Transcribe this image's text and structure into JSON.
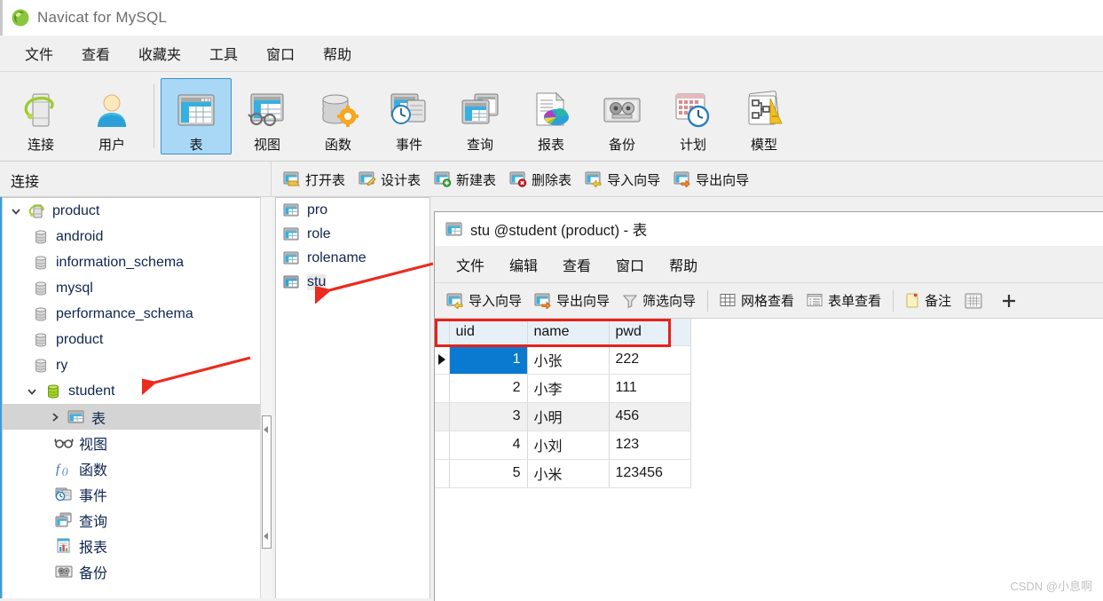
{
  "window": {
    "title": "Navicat for MySQL",
    "app_icon": "navicat-logo-icon"
  },
  "menubar": {
    "items": [
      {
        "label": "文件",
        "name": "menu-file"
      },
      {
        "label": "查看",
        "name": "menu-view"
      },
      {
        "label": "收藏夹",
        "name": "menu-favorites"
      },
      {
        "label": "工具",
        "name": "menu-tools"
      },
      {
        "label": "窗口",
        "name": "menu-window"
      },
      {
        "label": "帮助",
        "name": "menu-help"
      }
    ]
  },
  "toolbar": {
    "buttons": [
      {
        "label": "连接",
        "icon": "connection-icon",
        "selected": false
      },
      {
        "label": "用户",
        "icon": "user-icon",
        "selected": false
      },
      {
        "label": "表",
        "icon": "table-icon",
        "selected": true
      },
      {
        "label": "视图",
        "icon": "view-icon",
        "selected": false
      },
      {
        "label": "函数",
        "icon": "function-icon",
        "selected": false
      },
      {
        "label": "事件",
        "icon": "event-icon",
        "selected": false
      },
      {
        "label": "查询",
        "icon": "query-icon",
        "selected": false
      },
      {
        "label": "报表",
        "icon": "report-icon",
        "selected": false
      },
      {
        "label": "备份",
        "icon": "backup-icon",
        "selected": false
      },
      {
        "label": "计划",
        "icon": "schedule-icon",
        "selected": false
      },
      {
        "label": "模型",
        "icon": "model-icon",
        "selected": false
      }
    ]
  },
  "subbar": {
    "connections_label": "连接",
    "table_actions": [
      {
        "label": "打开表",
        "icon": "open-table-icon"
      },
      {
        "label": "设计表",
        "icon": "design-table-icon"
      },
      {
        "label": "新建表",
        "icon": "new-table-icon"
      },
      {
        "label": "删除表",
        "icon": "delete-table-icon"
      },
      {
        "label": "导入向导",
        "icon": "import-wizard-icon"
      },
      {
        "label": "导出向导",
        "icon": "export-wizard-icon"
      }
    ]
  },
  "tree": {
    "nodes": [
      {
        "label": "product",
        "icon": "server-connection-icon",
        "level": 1,
        "expander": "chevron-down-icon",
        "selected": false
      },
      {
        "label": "android",
        "icon": "database-icon",
        "level": 2,
        "expander": "none",
        "selected": false
      },
      {
        "label": "information_schema",
        "icon": "database-icon",
        "level": 2,
        "expander": "none",
        "selected": false
      },
      {
        "label": "mysql",
        "icon": "database-icon",
        "level": 2,
        "expander": "none",
        "selected": false
      },
      {
        "label": "performance_schema",
        "icon": "database-icon",
        "level": 2,
        "expander": "none",
        "selected": false
      },
      {
        "label": "product",
        "icon": "database-icon",
        "level": 2,
        "expander": "none",
        "selected": false
      },
      {
        "label": "ry",
        "icon": "database-icon",
        "level": 2,
        "expander": "none",
        "selected": false
      },
      {
        "label": "student",
        "icon": "database-open-icon",
        "level": 2,
        "expander": "chevron-down-icon",
        "selected": false
      },
      {
        "label": "表",
        "icon": "table-folder-icon",
        "level": 3,
        "expander": "chevron-right-icon",
        "selected": true
      },
      {
        "label": "视图",
        "icon": "view-folder-icon",
        "level": 3,
        "expander": "none",
        "selected": false
      },
      {
        "label": "函数",
        "icon": "function-folder-icon",
        "level": 3,
        "expander": "none",
        "selected": false
      },
      {
        "label": "事件",
        "icon": "event-folder-icon",
        "level": 3,
        "expander": "none",
        "selected": false
      },
      {
        "label": "查询",
        "icon": "query-folder-icon",
        "level": 3,
        "expander": "none",
        "selected": false
      },
      {
        "label": "报表",
        "icon": "report-folder-icon",
        "level": 3,
        "expander": "none",
        "selected": false
      },
      {
        "label": "备份",
        "icon": "backup-folder-icon",
        "level": 3,
        "expander": "none",
        "selected": false
      }
    ]
  },
  "table_list": {
    "items": [
      {
        "label": "pro",
        "icon": "table-icon",
        "selected": false
      },
      {
        "label": "role",
        "icon": "table-icon",
        "selected": false
      },
      {
        "label": "rolename",
        "icon": "table-icon",
        "selected": false
      },
      {
        "label": "stu",
        "icon": "table-icon",
        "selected": true
      }
    ]
  },
  "child_window": {
    "title": "stu @student (product) - 表",
    "icon": "table-icon",
    "menu": [
      {
        "label": "文件",
        "name": "child-menu-file"
      },
      {
        "label": "编辑",
        "name": "child-menu-edit"
      },
      {
        "label": "查看",
        "name": "child-menu-view"
      },
      {
        "label": "窗口",
        "name": "child-menu-window"
      },
      {
        "label": "帮助",
        "name": "child-menu-help"
      }
    ],
    "tools": [
      {
        "label": "导入向导",
        "icon": "import-wizard-icon"
      },
      {
        "label": "导出向导",
        "icon": "export-wizard-icon"
      },
      {
        "label": "筛选向导",
        "icon": "filter-icon"
      },
      {
        "label": "网格查看",
        "icon": "grid-view-icon"
      },
      {
        "label": "表单查看",
        "icon": "form-view-icon"
      },
      {
        "label": "备注",
        "icon": "note-icon"
      },
      {
        "label": "",
        "icon": "calendar-grid-icon"
      },
      {
        "label": "",
        "icon": "plus-icon"
      }
    ],
    "grid": {
      "columns": [
        "uid",
        "name",
        "pwd"
      ],
      "rows": [
        {
          "uid": "1",
          "name": "小张",
          "pwd": "222"
        },
        {
          "uid": "2",
          "name": "小李",
          "pwd": "111"
        },
        {
          "uid": "3",
          "name": "小明",
          "pwd": "456"
        },
        {
          "uid": "4",
          "name": "小刘",
          "pwd": "123"
        },
        {
          "uid": "5",
          "name": "小米",
          "pwd": "123456"
        }
      ],
      "selected_row_index": 0,
      "selected_column": "uid"
    }
  },
  "annotations": {
    "arrow_color": "#ec2b20",
    "header_highlight_color": "#e8221a",
    "arrows": [
      {
        "name": "arrow-to-stu-table",
        "target": "stu"
      },
      {
        "name": "arrow-to-student-db",
        "target": "student"
      }
    ]
  },
  "watermark": {
    "text": "CSDN @小息啊"
  },
  "colors": {
    "accent_blue": "#0a7ad0",
    "toolbar_selected": "#a8d8f6",
    "header_bg": "#e8f0f7",
    "window_bg": "#f0f0f0"
  }
}
